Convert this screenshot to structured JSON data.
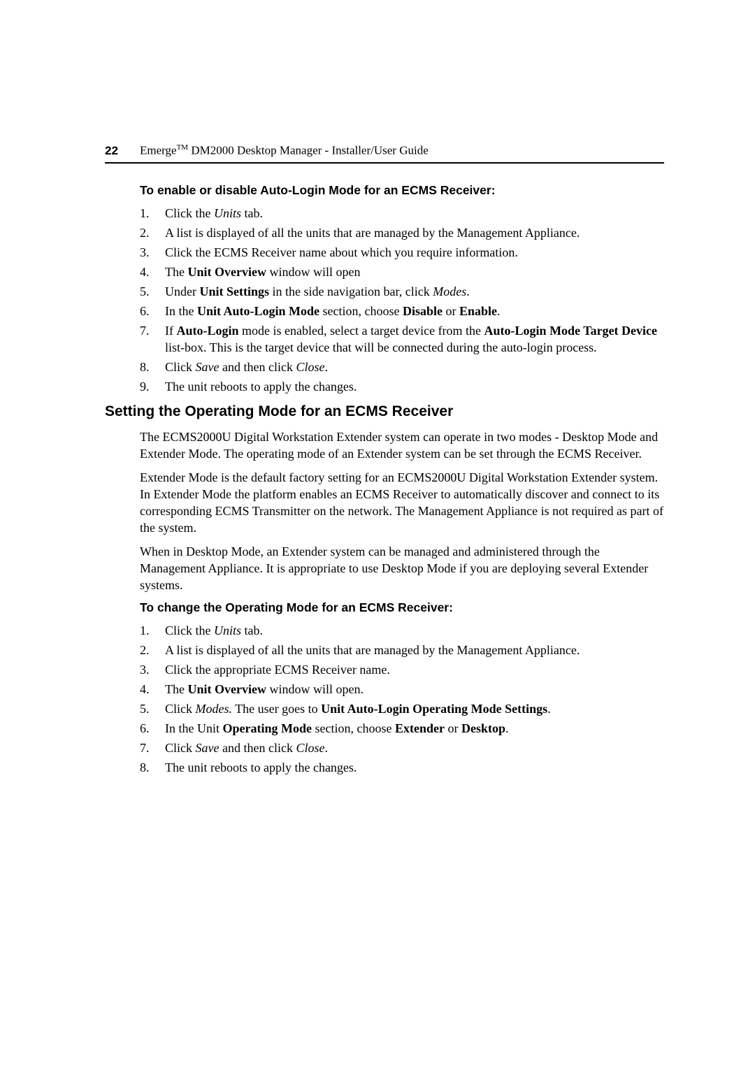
{
  "header": {
    "page_number": "22",
    "title_prefix": "Emerge",
    "title_tm": "TM",
    "title_suffix": " DM2000 Desktop Manager - Installer/User Guide"
  },
  "section1": {
    "heading": "To enable or disable Auto-Login Mode for an ECMS Receiver:",
    "steps": {
      "s1": {
        "a": "Click the ",
        "b": "Units",
        "c": " tab."
      },
      "s2": {
        "a": "A list is displayed of all the units that are managed by the Management Appliance."
      },
      "s3": {
        "a": "Click the ECMS Receiver name about which you require information."
      },
      "s4": {
        "a": "The ",
        "b": "Unit Overview",
        "c": " window will open"
      },
      "s5": {
        "a": "Under ",
        "b": "Unit Settings",
        "c": " in the side navigation bar, click ",
        "d": "Modes",
        "e": "."
      },
      "s6": {
        "a": "In the ",
        "b": "Unit Auto-Login Mode",
        "c": " section, choose ",
        "d": "Disable",
        "e": " or ",
        "f": "Enable",
        "g": "."
      },
      "s7": {
        "a": "If ",
        "b": "Auto-Login",
        "c": " mode is enabled, select a target device from the ",
        "d": "Auto-Login Mode Target Device",
        "e": " list-box. This is the target device that will be connected during the auto-login process."
      },
      "s8": {
        "a": "Click ",
        "b": "Save",
        "c": " and then click ",
        "d": "Close",
        "e": "."
      },
      "s9": {
        "a": "The unit reboots to apply the changes."
      }
    }
  },
  "h2": "Setting the Operating Mode for an ECMS Receiver",
  "para1": "The ECMS2000U Digital Workstation Extender system can operate in two modes - Desktop Mode and Extender Mode. The operating mode of an Extender system can be set through the ECMS Receiver.",
  "para2": "Extender Mode is the default factory setting for an ECMS2000U Digital Workstation Extender system. In Extender Mode the platform enables an ECMS Receiver to automatically discover and connect to its corresponding ECMS Transmitter on the network. The Management Appliance is not required as part of the system.",
  "para3": "When in Desktop Mode, an Extender system can be managed and administered through the Management Appliance. It is appropriate to use Desktop Mode if you are deploying several Extender systems.",
  "section2": {
    "heading": "To change the Operating Mode for an ECMS Receiver:",
    "steps": {
      "s1": {
        "a": "Click the ",
        "b": "Units",
        "c": " tab."
      },
      "s2": {
        "a": "A list is displayed of all the units that are managed by the Management Appliance."
      },
      "s3": {
        "a": "Click the appropriate ECMS Receiver name."
      },
      "s4": {
        "a": "The ",
        "b": "Unit Overview",
        "c": " window will open."
      },
      "s5": {
        "a": "Click ",
        "b": "Modes.",
        "c": " The user goes to ",
        "d": "Unit Auto-Login Operating Mode Settings",
        "e": "."
      },
      "s6": {
        "a": "In the Unit ",
        "b": "Operating Mode",
        "c": " section, choose ",
        "d": "Extender",
        "e": " or ",
        "f": "Desktop",
        "g": "."
      },
      "s7": {
        "a": "Click ",
        "b": "Save",
        "c": " and then click ",
        "d": "Close",
        "e": "."
      },
      "s8": {
        "a": "The unit reboots to apply the changes."
      }
    }
  }
}
